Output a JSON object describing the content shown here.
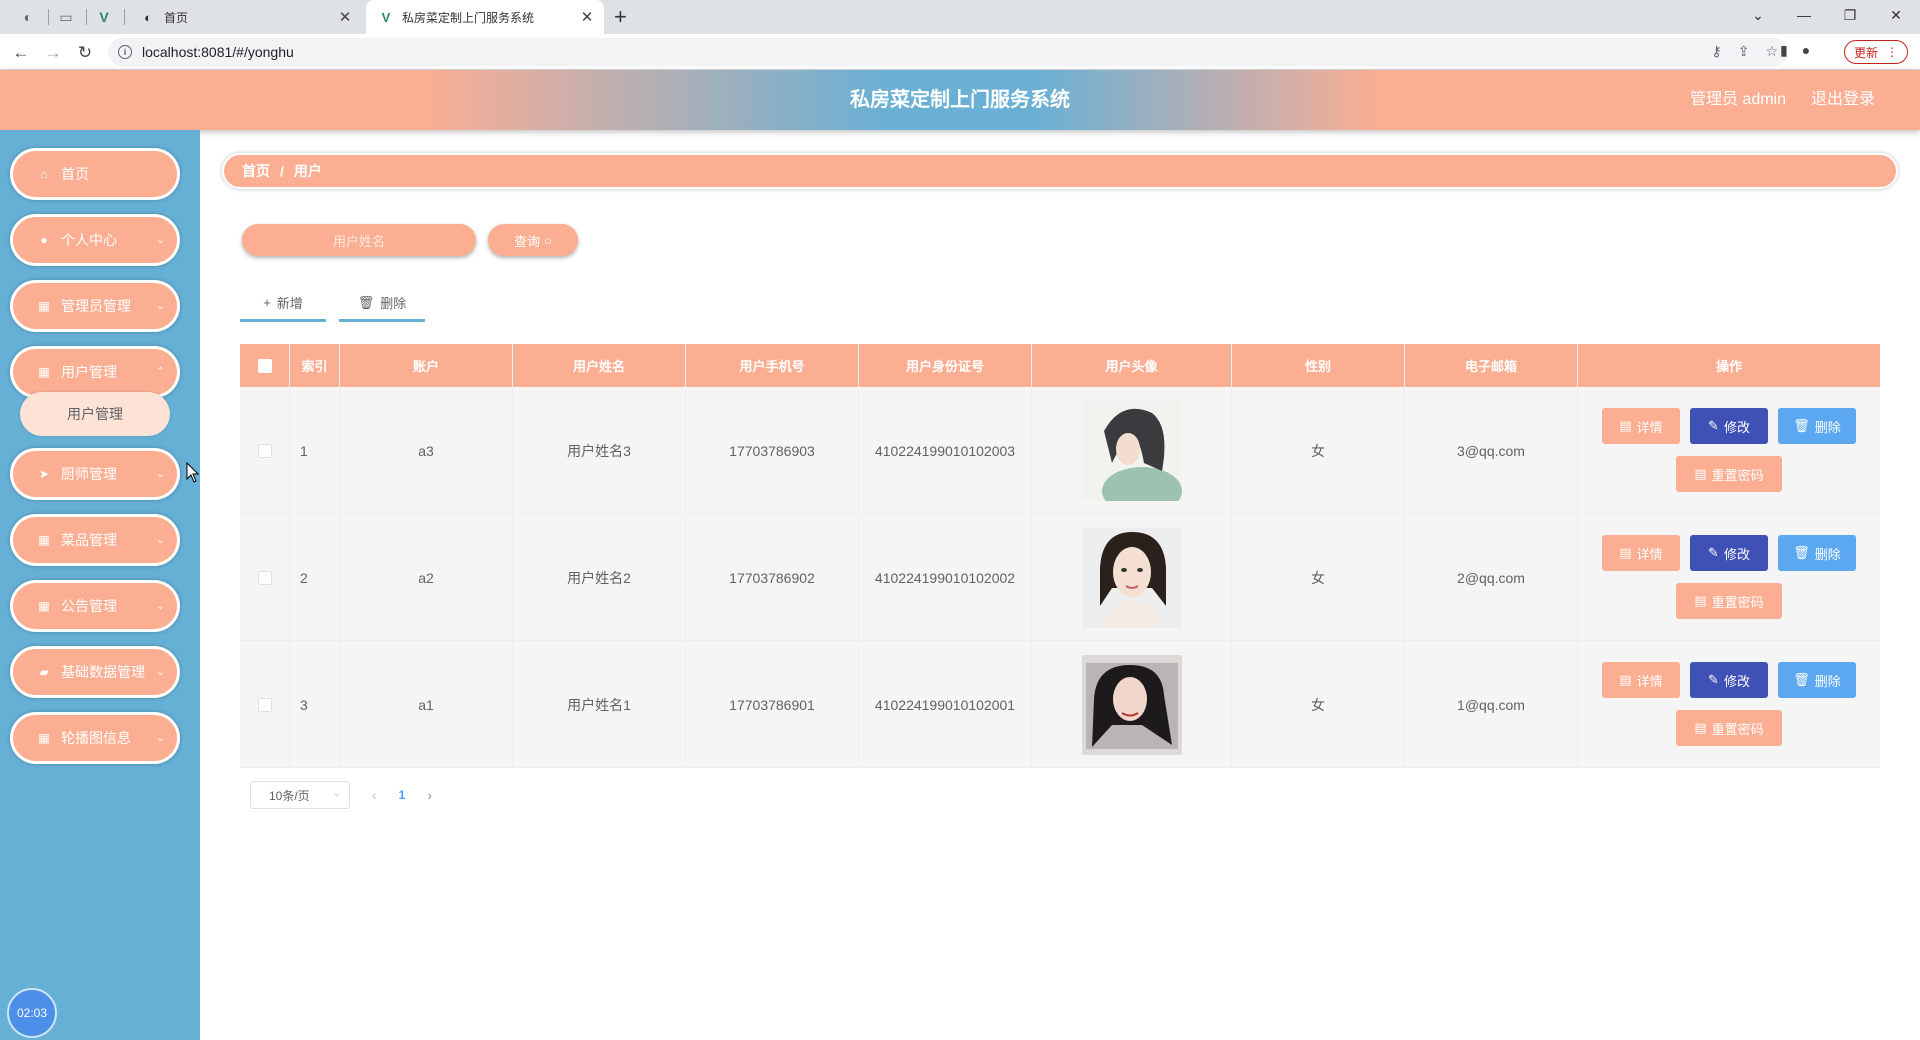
{
  "browser": {
    "tabs": [
      {
        "title": "首页"
      },
      {
        "title": "私房菜定制上门服务系统"
      }
    ],
    "url": "localhost:8081/#/yonghu",
    "update_label": "更新"
  },
  "header": {
    "title": "私房菜定制上门服务系统",
    "user": "管理员 admin",
    "logout": "退出登录"
  },
  "sidebar": {
    "items": [
      {
        "label": "首页",
        "icon": "home-icon"
      },
      {
        "label": "个人中心",
        "icon": "user-icon"
      },
      {
        "label": "管理员管理",
        "icon": "grid-icon"
      },
      {
        "label": "用户管理",
        "icon": "grid-icon"
      },
      {
        "label": "厨师管理",
        "icon": "send-icon"
      },
      {
        "label": "菜品管理",
        "icon": "grid-icon"
      },
      {
        "label": "公告管理",
        "icon": "grid-icon"
      },
      {
        "label": "基础数据管理",
        "icon": "briefcase-icon"
      },
      {
        "label": "轮播图信息",
        "icon": "grid-icon"
      }
    ],
    "subitem": "用户管理",
    "timer": "02:03"
  },
  "breadcrumb": {
    "home": "首页",
    "sep": "/",
    "current": "用户"
  },
  "search": {
    "placeholder": "用户姓名",
    "button": "查询"
  },
  "actions": {
    "add": "新增",
    "delete": "删除"
  },
  "table": {
    "headers": [
      "索引",
      "账户",
      "用户姓名",
      "用户手机号",
      "用户身份证号",
      "用户头像",
      "性别",
      "电子邮箱",
      "操作"
    ],
    "rows": [
      {
        "index": "1",
        "account": "a3",
        "name": "用户姓名3",
        "phone": "17703786903",
        "idcard": "410224199010102003",
        "gender": "女",
        "email": "3@qq.com"
      },
      {
        "index": "2",
        "account": "a2",
        "name": "用户姓名2",
        "phone": "17703786902",
        "idcard": "410224199010102002",
        "gender": "女",
        "email": "2@qq.com"
      },
      {
        "index": "3",
        "account": "a1",
        "name": "用户姓名1",
        "phone": "17703786901",
        "idcard": "410224199010102001",
        "gender": "女",
        "email": "1@qq.com"
      }
    ],
    "ops": {
      "detail": "详情",
      "edit": "修改",
      "delete": "删除",
      "reset": "重置密码"
    }
  },
  "pager": {
    "size": "10条/页",
    "page": "1"
  },
  "colors": {
    "accent": "#fcae93",
    "sidebar": "#66b0d6",
    "edit": "#3f51b5",
    "delete": "#5ba8f0"
  }
}
